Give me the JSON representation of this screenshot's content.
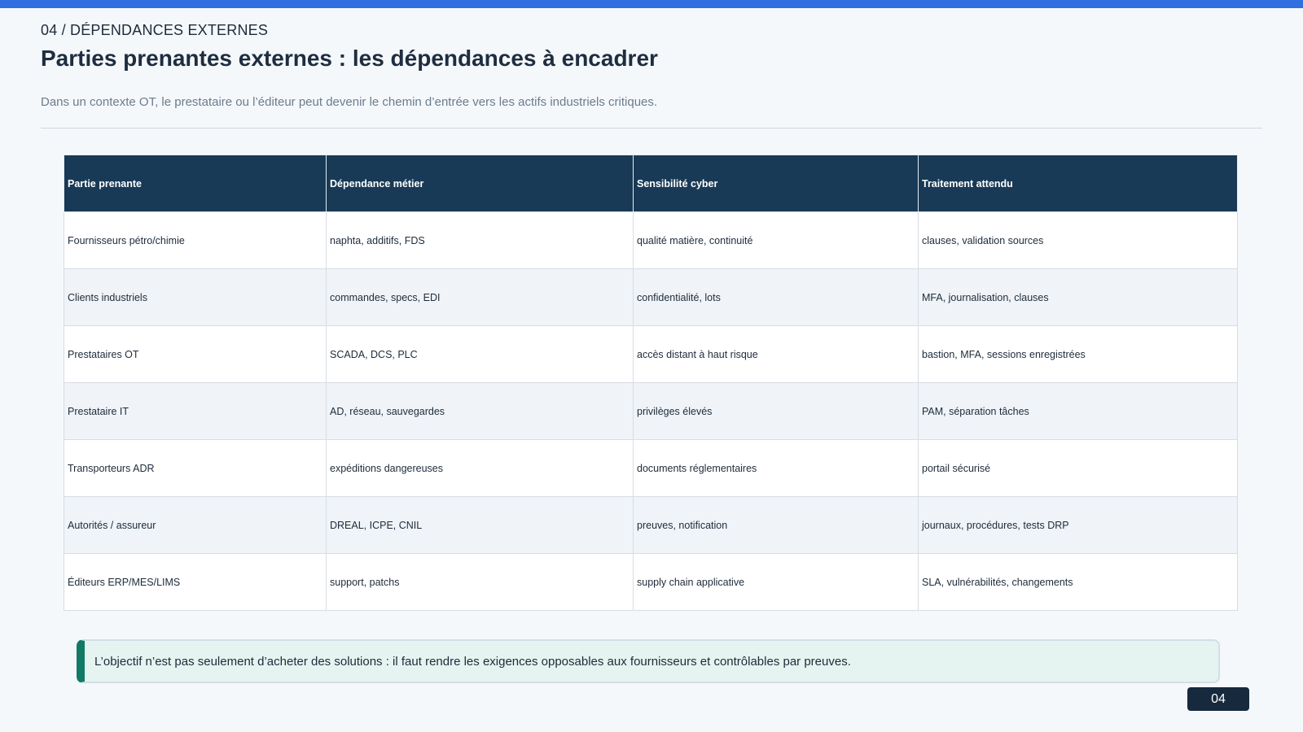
{
  "header": {
    "kicker": "04 / DÉPENDANCES EXTERNES",
    "title": "Parties prenantes externes : les dépendances à encadrer",
    "subtitle": "Dans un contexte OT, le prestataire ou l’éditeur peut devenir le chemin d’entrée vers les actifs industriels critiques."
  },
  "table": {
    "columns": [
      "Partie prenante",
      "Dépendance métier",
      "Sensibilité cyber",
      "Traitement attendu"
    ],
    "rows": [
      [
        "Fournisseurs pétro/chimie",
        "naphta, additifs, FDS",
        "qualité matière, continuité",
        "clauses, validation sources"
      ],
      [
        "Clients industriels",
        "commandes, specs, EDI",
        "confidentialité, lots",
        "MFA, journalisation, clauses"
      ],
      [
        "Prestataires OT",
        "SCADA, DCS, PLC",
        "accès distant à haut risque",
        "bastion, MFA, sessions enregistrées"
      ],
      [
        "Prestataire IT",
        "AD, réseau, sauvegardes",
        "privilèges élevés",
        "PAM, séparation tâches"
      ],
      [
        "Transporteurs ADR",
        "expéditions dangereuses",
        "documents réglementaires",
        "portail sécurisé"
      ],
      [
        "Autorités / assureur",
        "DREAL, ICPE, CNIL",
        "preuves, notification",
        "journaux, procédures, tests DRP"
      ],
      [
        "Éditeurs ERP/MES/LIMS",
        "support, patchs",
        "supply chain applicative",
        "SLA, vulnérabilités, changements"
      ]
    ]
  },
  "callout": {
    "text": "L’objectif n’est pas seulement d’acheter des solutions : il faut rendre les exigences opposables aux fournisseurs et contrôlables par preuves."
  },
  "footer": {
    "page_number": "04"
  },
  "colors": {
    "accent_bar": "#2f6fdf",
    "table_header": "#183a56",
    "callout_accent": "#117a65",
    "callout_bg": "#e5f4f0",
    "badge_bg": "#16293d"
  }
}
